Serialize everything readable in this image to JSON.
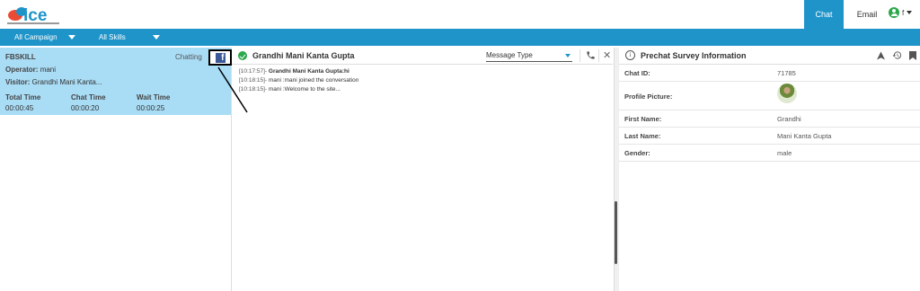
{
  "header": {
    "logo_text": "ice",
    "nav": {
      "chat": "Chat",
      "email": "Email"
    },
    "user_initial": "f"
  },
  "toolbar": {
    "campaign": "All Campaign",
    "skills": "All Skills"
  },
  "session": {
    "skill": "FBSKILL",
    "status": "Chatting",
    "operator_label": "Operator:",
    "operator": "mani",
    "visitor_label": "Visitor:",
    "visitor": "Grandhi Mani Kanta...",
    "total_time_label": "Total Time",
    "chat_time_label": "Chat Time",
    "wait_time_label": "Wait Time",
    "total_time": "00:00:45",
    "chat_time": "00:00:20",
    "wait_time": "00:00:25"
  },
  "conversation": {
    "title": "Grandhi Mani Kanta Gupta",
    "message_type_placeholder": "Message Type",
    "messages": [
      {
        "time": "[10:17:57]-",
        "who": "Grandhi Mani Kanta Gupta",
        "text": ":hi"
      },
      {
        "time": "[10:18:15]-",
        "who": "",
        "text": "mani :mani joined the conversation"
      },
      {
        "time": "[10:18:15]-",
        "who": "",
        "text": "mani :Welcome to the site..."
      }
    ]
  },
  "survey": {
    "title": "Prechat Survey Information",
    "rows": [
      {
        "label": "Chat ID:",
        "value": "71785"
      },
      {
        "label": "Profile Picture:",
        "value": ""
      },
      {
        "label": "First Name:",
        "value": "Grandhi"
      },
      {
        "label": "Last Name:",
        "value": "Mani Kanta Gupta"
      },
      {
        "label": "Gender:",
        "value": "male"
      }
    ]
  },
  "colors": {
    "accent": "#1f94c9",
    "card": "#a9dcf5",
    "success": "#2aa84a",
    "facebook": "#3b5998"
  },
  "icons": [
    "facebook-icon",
    "check-circle-icon",
    "phone-icon",
    "close-icon",
    "info-icon",
    "navigate-icon",
    "history-icon",
    "bookmark-icon",
    "user-icon"
  ]
}
